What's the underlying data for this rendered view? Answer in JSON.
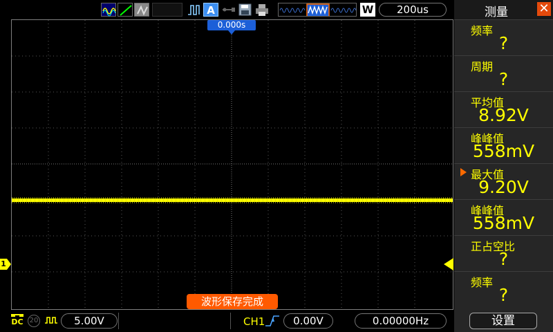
{
  "top_bar": {
    "trigger_mode": "A",
    "timebase_mode": "W",
    "timebase": "200us",
    "trigger_position": "0.000s"
  },
  "screen": {
    "status_message": "波形保存完成",
    "ch1_marker": "1",
    "trace_color": "#ffff00"
  },
  "bottom_bar": {
    "ch1_coupling": "DC",
    "bw_limit": "20",
    "ch1_scale": "5.00V",
    "trigger_source": "CH1",
    "trigger_level": "0.00V",
    "frequency": "0.00000Hz"
  },
  "measure_panel": {
    "title": "测量",
    "items": [
      {
        "label": "频率",
        "value": "?"
      },
      {
        "label": "周期",
        "value": "?"
      },
      {
        "label": "平均值",
        "value": "8.92V"
      },
      {
        "label": "峰峰值",
        "value": "558mV"
      },
      {
        "label": "最大值",
        "value": "9.20V"
      },
      {
        "label": "峰峰值",
        "value": "558mV"
      },
      {
        "label": "正占空比",
        "value": "?"
      },
      {
        "label": "频率",
        "value": "?"
      }
    ],
    "settings_label": "设置"
  },
  "colors": {
    "accent": "#ff6a00",
    "trigger_blue": "#1c5fd8",
    "measurement_yellow": "#ffff00"
  }
}
